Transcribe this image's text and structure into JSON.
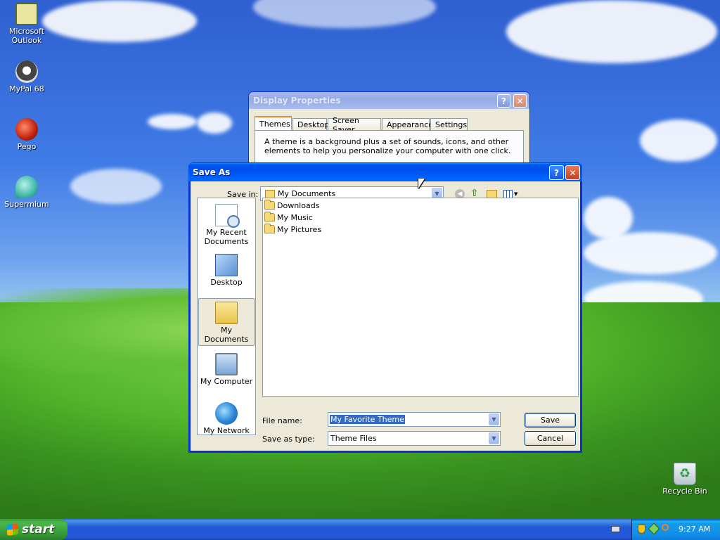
{
  "desktop": {
    "icons": [
      {
        "label": "Microsoft Outlook",
        "icon": "outlook-icon"
      },
      {
        "label": "MyPal 68",
        "icon": "mypal-icon"
      },
      {
        "label": "Pego",
        "icon": "pego-icon"
      },
      {
        "label": "Supermium",
        "icon": "supermium-icon"
      },
      {
        "label": "Recycle Bin",
        "icon": "recycle-bin-icon"
      }
    ]
  },
  "display_properties": {
    "title": "Display Properties",
    "tabs": [
      "Themes",
      "Desktop",
      "Screen Saver",
      "Appearance",
      "Settings"
    ],
    "active_tab": "Themes",
    "description": "A theme is a background plus a set of sounds, icons, and other elements to help you personalize your computer with one click."
  },
  "save_as": {
    "title": "Save As",
    "save_in_label": "Save in:",
    "save_in_value": "My Documents",
    "places": [
      {
        "label": "My Recent Documents",
        "icon": "recent-documents-icon"
      },
      {
        "label": "Desktop",
        "icon": "desktop-icon"
      },
      {
        "label": "My Documents",
        "icon": "my-documents-icon",
        "selected": true
      },
      {
        "label": "My Computer",
        "icon": "my-computer-icon"
      },
      {
        "label": "My Network",
        "icon": "my-network-icon"
      }
    ],
    "files": [
      "Downloads",
      "My Music",
      "My Pictures"
    ],
    "file_name_label": "File name:",
    "file_name_value": "My Favorite Theme",
    "save_type_label": "Save as type:",
    "save_type_value": "Theme Files",
    "save_button": "Save",
    "cancel_button": "Cancel"
  },
  "taskbar": {
    "start_label": "start",
    "clock": "9:27 AM"
  },
  "colors": {
    "title_active": "#0054e3",
    "start_green": "#3c9b3c",
    "selection": "#316ac5"
  }
}
